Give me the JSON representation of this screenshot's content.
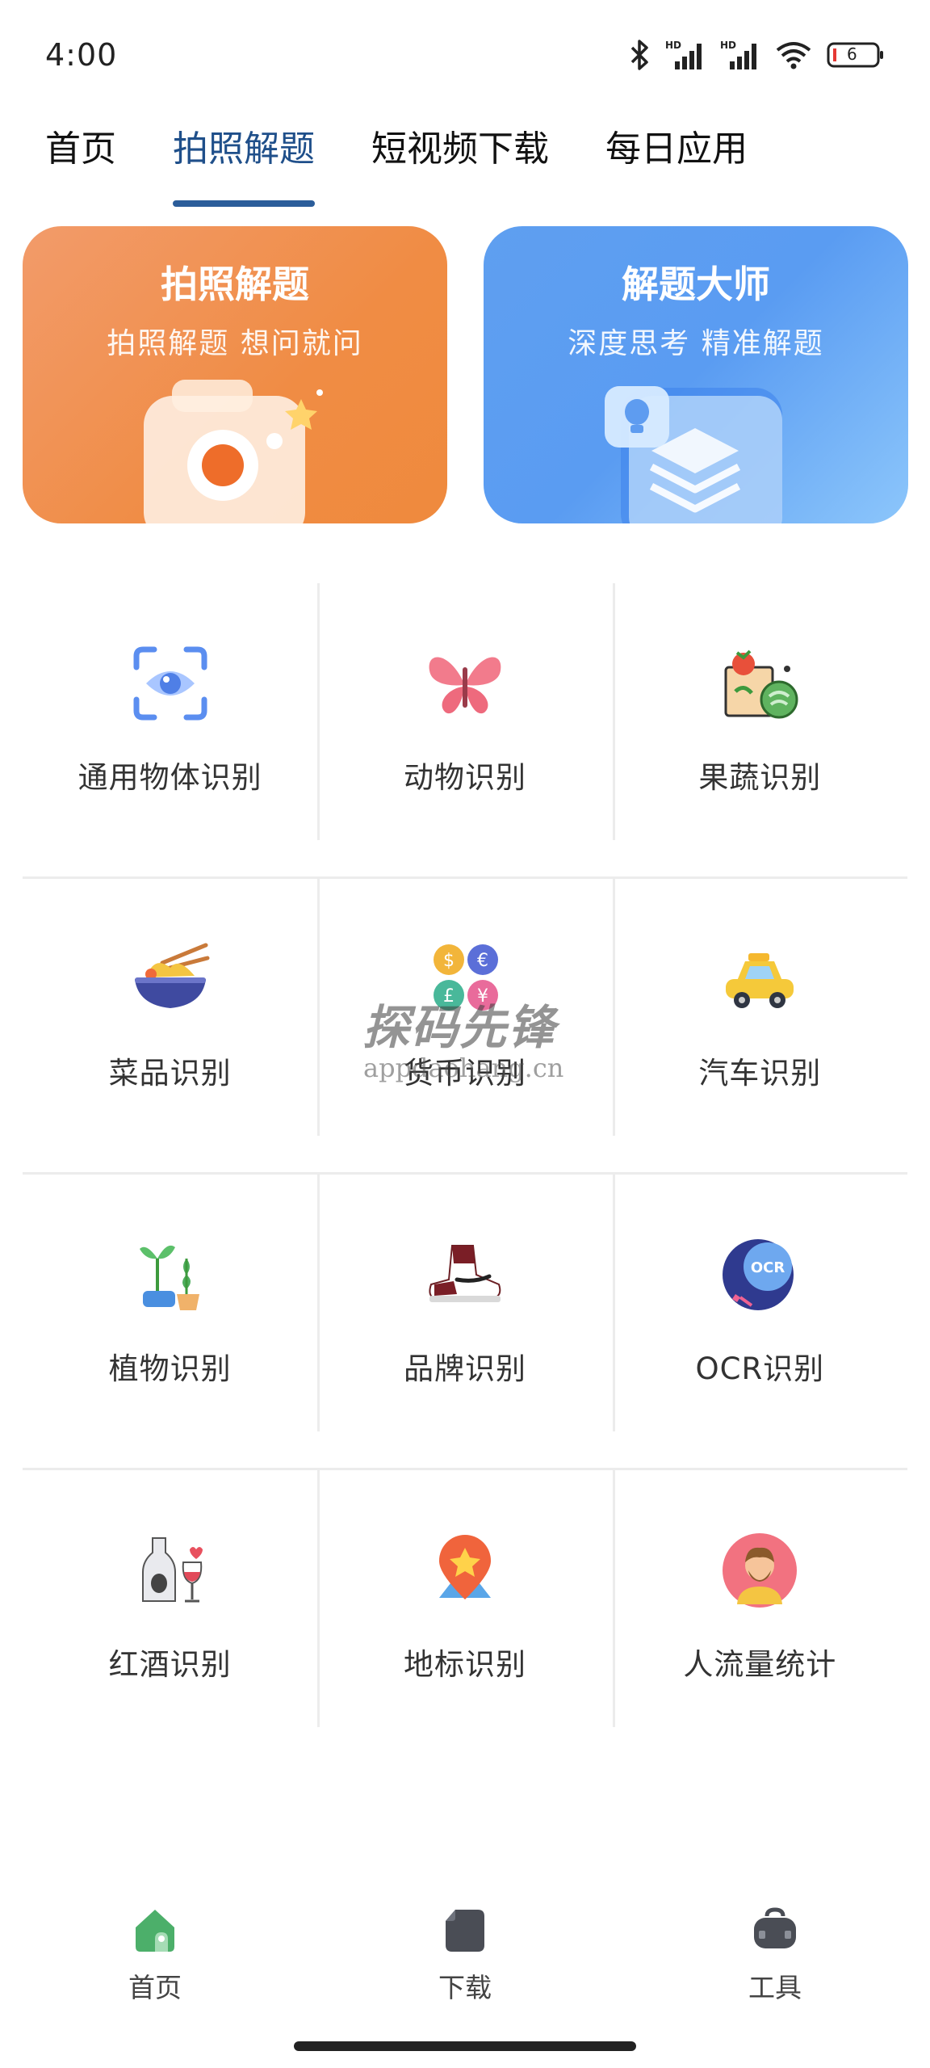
{
  "status_bar": {
    "time": "4:00",
    "battery_level": "6",
    "icons": [
      "bluetooth-icon",
      "signal-hd-icon",
      "signal-hd-icon",
      "wifi-icon",
      "battery-icon"
    ]
  },
  "tabs": [
    {
      "label": "首页",
      "active": false
    },
    {
      "label": "拍照解题",
      "active": true
    },
    {
      "label": "短视频下载",
      "active": false
    },
    {
      "label": "每日应用",
      "active": false
    }
  ],
  "hero_cards": [
    {
      "title": "拍照解题",
      "subtitle": "拍照解题  想问就问",
      "icon": "camera-icon",
      "color": "#ef8a3d"
    },
    {
      "title": "解题大师",
      "subtitle": "深度思考  精准解题",
      "icon": "layers-icon",
      "color": "#5a9cf2"
    }
  ],
  "grid": [
    [
      {
        "label": "通用物体识别",
        "icon": "scan-eye-icon"
      },
      {
        "label": "动物识别",
        "icon": "butterfly-icon"
      },
      {
        "label": "果蔬识别",
        "icon": "vegetables-icon"
      }
    ],
    [
      {
        "label": "菜品识别",
        "icon": "noodle-bowl-icon"
      },
      {
        "label": "货币识别",
        "icon": "coins-icon"
      },
      {
        "label": "汽车识别",
        "icon": "car-icon"
      }
    ],
    [
      {
        "label": "植物识别",
        "icon": "plant-icon"
      },
      {
        "label": "品牌识别",
        "icon": "sneaker-icon"
      },
      {
        "label": "OCR识别",
        "icon": "ocr-icon"
      }
    ],
    [
      {
        "label": "红酒识别",
        "icon": "wine-icon"
      },
      {
        "label": "地标识别",
        "icon": "landmark-pin-icon"
      },
      {
        "label": "人流量统计",
        "icon": "person-icon"
      }
    ]
  ],
  "watermark": {
    "title": "探码先锋",
    "url": "appdaohang.cn"
  },
  "bottom_nav": [
    {
      "label": "首页",
      "icon": "home-icon",
      "active": true
    },
    {
      "label": "下载",
      "icon": "folder-icon",
      "active": false
    },
    {
      "label": "工具",
      "icon": "toolbox-icon",
      "active": false
    }
  ]
}
